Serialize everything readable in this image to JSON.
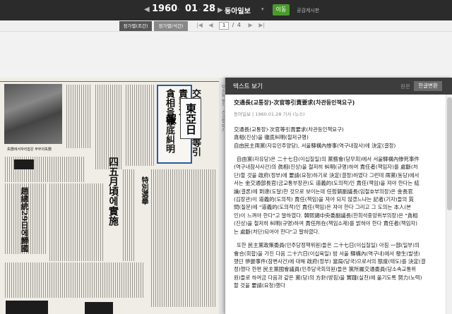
{
  "nav": {
    "prev_year": "◀",
    "year": "1960",
    "next_year": "▶",
    "month": "01",
    "day": "28",
    "sep_dot": "·",
    "newspaper": "동아일보",
    "dropdown": "▾",
    "go_label": "이동",
    "board_label": "공감게시판"
  },
  "edition_tabs": [
    "정가별(조간)",
    "정가별(석간)"
  ],
  "pager": {
    "first": "|◀",
    "prev": "◀",
    "current": "1",
    "sep": "/",
    "total": "4",
    "next": "▶",
    "last": "▶|"
  },
  "newspaper_image": {
    "headline_1": "交通長·次官等引責要求",
    "headline_2": "貪相을徹底糾明",
    "logo": "東亞日報",
    "big_1": "四五月頃에實施",
    "big_2": "特別選舉",
    "small_headline": "趙總統29日에歸國",
    "caption": "失態에서자리잡은 부부의失態",
    "sidetab": [
      "텍스트 보기",
      "스크랩 하기"
    ]
  },
  "panel": {
    "title": "텍스트 보기",
    "orig_label": "원문",
    "conv_label": "한글변환",
    "article_title": "交通長(교통장)·次官等引責要求(차관등인책요구)",
    "meta": "동아일보 | 1960.01.28 기사 (뉴스)",
    "lead_lines": [
      "交通長(교통장)·次官等引責要求(차관등인책요구)",
      "貪相(진상)을 徹底糾明(철저규명)",
      "自由民主兩黨(자유민주양당), 서울驛構內惨事(역구내참사)에 決定(결정)"
    ],
    "para1": [
      "自由黨(자유당)은 二十七日(이십칠일)의 黨務會(당무회)에서 서울驛構內惨死事件",
      "(역구내참사사건)의 眞相(진상)을 철저히 糾明(규명)하여 責任者(책임자)를 處斷(처",
      "단)할 것을 政府(정부)에 要請(요청)하기로 決定(결정)하였다 그런데 兩黨(동당)에서",
      "서는 金交通部長官(금교통부장관)도 道義的(도의적)인 責任(책임)을 져야 한다는 結",
      "論(결론)에 到達(도달)한 것으로 보이는데 任哲鎬副議長(임철호부의장)은 金長官",
      "(김장관)이 道義的(도의적) 責任(책임)을 져야 되지 않겠느냐는 記者(기자)들의 質",
      "問(질문)에 \"道義的(도의적)인 責任(책임)은 져야 한다 그리고 그 도의는 本人(본",
      "인)이 느껴야 한다\"고 말하였다. 韓熙錫中央委副議長(한희석중앙위부의장)은 \"貪相",
      "(진상)을 철저히 糾明(규명)하여 責任所在(책임소재)를 밝혀야 한다 責任者(책임자)",
      "는 處斷(처단)되어야 한다\"고 말하였다."
    ],
    "para2": [
      "또한 民主黨政策委員(민주당정책위원)들은 二十七日(이십칠일) 아침 一部(일부)의",
      "會合(회합)을 가진 다음 二十六日(이십육일) 밤 서울 驛構內(역구내)에서 發生(발생)",
      "했던 慘變事件(참변사건)에 대해 政府(정부) 當局(당국)으로서의 態度(태도)를 決定(결",
      "정)했다 한편 民主黨國會議員(민주당국회의원)들은 黨所屬交通委員(당소속교통위",
      "원)들로 하여금 다음과 같은 黨(당)의 方針(방침)을 實踐(실천)에 옮기도록 努力(노력)",
      "할 것을 要請(요청)했다"
    ]
  }
}
